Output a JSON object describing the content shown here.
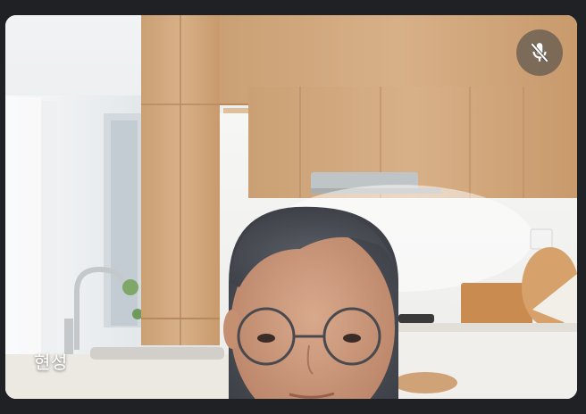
{
  "participant": {
    "name": "현성",
    "mic_status_icon": "mic-off-icon"
  },
  "colors": {
    "background": "#202124",
    "mute_button_bg": "#3c4043",
    "label_text": "#ffffff"
  }
}
